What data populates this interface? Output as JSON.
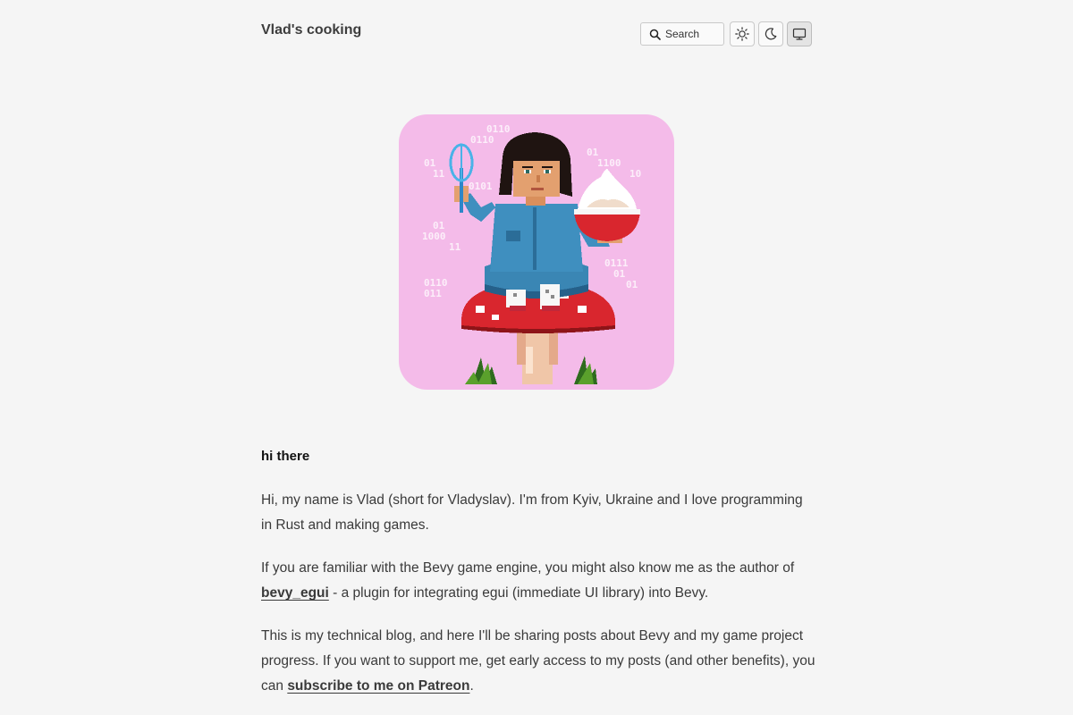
{
  "header": {
    "site_title": "Vlad's cooking",
    "search_label": "Search",
    "theme_buttons": [
      {
        "icon": "sun-icon",
        "name": "light-theme-button"
      },
      {
        "icon": "moon-icon",
        "name": "dark-theme-button"
      },
      {
        "icon": "monitor-icon",
        "name": "system-theme-button",
        "active": true
      }
    ]
  },
  "avatar": {
    "background_color": "#f4bbe9",
    "binary_glyphs": [
      "0110",
      "0110",
      "01",
      "11",
      "0101",
      "01",
      "1100",
      "10",
      "01",
      "1000",
      "11",
      "0111",
      "01",
      "01",
      "0110",
      "011"
    ]
  },
  "intro": {
    "greeting": "hi there",
    "p1": "Hi, my name is Vlad (short for Vladyslav). I'm from Kyiv, Ukraine and I love programming in Rust and making games.",
    "p2_before": "If you are familiar with the Bevy game engine, you might also know me as the author of ",
    "p2_link": "bevy_egui",
    "p2_after": " - a plugin for integrating egui (immediate UI library) into Bevy.",
    "p3_before": "This is my technical blog, and here I'll be sharing posts about Bevy and my game project progress. If you want to support me, get early access to my posts (and other benefits), you can ",
    "p3_link": "subscribe to me on Patreon",
    "p3_after": "."
  }
}
